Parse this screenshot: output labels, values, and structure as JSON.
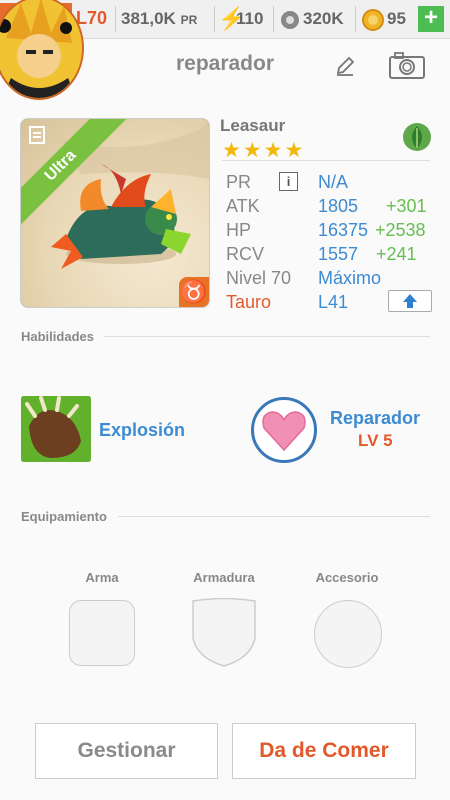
{
  "status_bar": {
    "level": "L70",
    "power": "381,0K",
    "power_unit": "PR",
    "stamina": "110",
    "food": "320K",
    "gold": "95",
    "add_label": "+"
  },
  "title_bar": {
    "title": "reparador",
    "edit_icon": "pencil-icon",
    "camera_icon": "camera-icon"
  },
  "monster": {
    "name": "Leasaur",
    "rarity": "Ultra",
    "stars": "★★★★",
    "element": "nature-leaf-icon",
    "zodiac_symbol": "♉",
    "stats": [
      {
        "label": "PR",
        "value": "N/A",
        "bonus": ""
      },
      {
        "label": "ATK",
        "value": "1805",
        "bonus": "+301"
      },
      {
        "label": "HP",
        "value": "16375",
        "bonus": "+2538"
      },
      {
        "label": "RCV",
        "value": "1557",
        "bonus": "+241"
      },
      {
        "label": "Nivel 70",
        "value": "Máximo",
        "bonus": ""
      },
      {
        "label": "Tauro",
        "value": "L41",
        "bonus": ""
      }
    ],
    "colors": {
      "label": "#888888",
      "value": "#3d8bd1",
      "bonus": "#65bf4f",
      "zodiac": "#e2592b"
    }
  },
  "abilities": {
    "heading": "Habilidades",
    "skill_name": "Explosión",
    "ability_name": "Reparador",
    "ability_level": "LV 5"
  },
  "equipment": {
    "heading": "Equipamiento",
    "slots": [
      "Arma",
      "Armadura",
      "Accesorio"
    ]
  },
  "actions": {
    "manage": "Gestionar",
    "feed": "Da de Comer"
  }
}
